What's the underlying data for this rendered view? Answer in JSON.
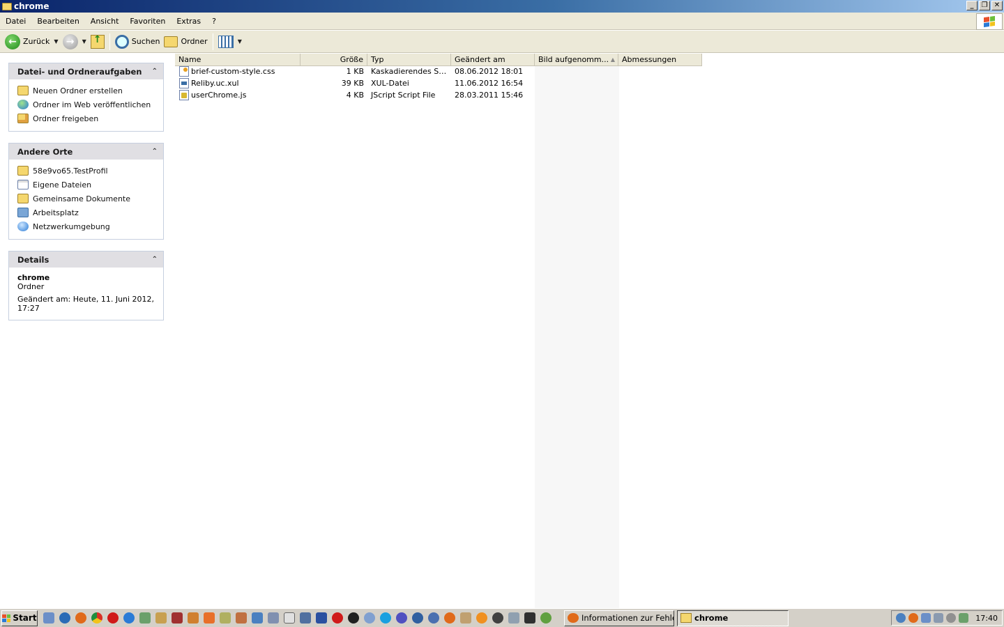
{
  "window": {
    "title": "chrome",
    "controls": [
      "_",
      "❐",
      "✕"
    ]
  },
  "menubar": {
    "items": [
      "Datei",
      "Bearbeiten",
      "Ansicht",
      "Favoriten",
      "Extras",
      "?"
    ]
  },
  "toolbar": {
    "back_label": "Zurück",
    "search_label": "Suchen",
    "folders_label": "Ordner"
  },
  "tasks_panel": {
    "title": "Datei- und Ordneraufgaben",
    "items": [
      "Neuen Ordner erstellen",
      "Ordner im Web veröffentlichen",
      "Ordner freigeben"
    ]
  },
  "places_panel": {
    "title": "Andere Orte",
    "items": [
      "58e9vo65.TestProfil",
      "Eigene Dateien",
      "Gemeinsame Dokumente",
      "Arbeitsplatz",
      "Netzwerkumgebung"
    ]
  },
  "details_panel": {
    "title": "Details",
    "name": "chrome",
    "type": "Ordner",
    "modified": "Geändert am: Heute, 11. Juni 2012, 17:27"
  },
  "columns": [
    "Name",
    "Größe",
    "Typ",
    "Geändert am",
    "Bild aufgenomm...",
    "Abmessungen"
  ],
  "files": [
    {
      "name": "brief-custom-style.css",
      "size": "1 KB",
      "type": "Kaskadierendes Styl...",
      "modified": "08.06.2012 18:01",
      "icon": "css-file-icon"
    },
    {
      "name": "Reliby.uc.xul",
      "size": "39 KB",
      "type": "XUL-Datei",
      "modified": "11.06.2012 16:54",
      "icon": "xul-file-icon"
    },
    {
      "name": "userChrome.js",
      "size": "4 KB",
      "type": "JScript Script File",
      "modified": "28.03.2011 15:46",
      "icon": "js-file-icon"
    }
  ],
  "taskbar": {
    "start_label": "Start",
    "tasks": [
      "Informationen zur Fehler...",
      "chrome"
    ],
    "clock": "17:40"
  },
  "colors": {
    "title_gradient_start": "#0a246a",
    "title_gradient_end": "#a6caf0",
    "chrome_bg": "#ece9d8",
    "panel_header": "#e0dfe3",
    "sorted_column": "#f7f7f7"
  }
}
